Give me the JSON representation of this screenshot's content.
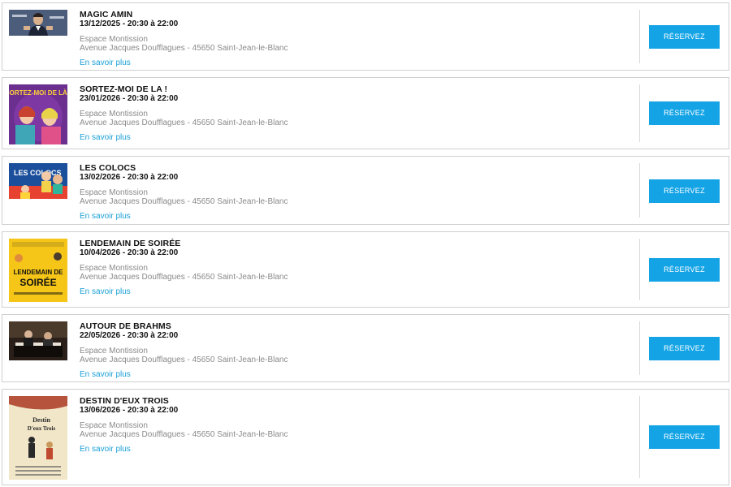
{
  "events": [
    {
      "title": "MAGIC AMIN",
      "datetime": "13/12/2025 - 20:30 à 22:00",
      "venue": "Espace Montission",
      "address": "Avenue Jacques Doufflagues - 45650 Saint-Jean-le-Blanc",
      "more_label": "En savoir plus",
      "reserve_label": "RÉSERVEZ",
      "image": "magician-portrait"
    },
    {
      "title": "SORTEZ-MOI DE LA !",
      "datetime": "23/01/2026 - 20:30 à 22:00",
      "venue": "Espace Montission",
      "address": "Avenue Jacques Doufflagues - 45650 Saint-Jean-le-Blanc",
      "more_label": "En savoir plus",
      "reserve_label": "RÉSERVEZ",
      "image": "comedy-poster-purple",
      "poster_text": "SORTEZ-MOI DE LÀ !"
    },
    {
      "title": "LES COLOCS",
      "datetime": "13/02/2026 - 20:30 à 22:00",
      "venue": "Espace Montission",
      "address": "Avenue Jacques Doufflagues - 45650 Saint-Jean-le-Blanc",
      "more_label": "En savoir plus",
      "reserve_label": "RÉSERVEZ",
      "image": "comic-poster-blue",
      "poster_text": "LES COLOCS"
    },
    {
      "title": "LENDEMAIN DE SOIRÉE",
      "datetime": "10/04/2026 - 20:30 à 22:00",
      "venue": "Espace Montission",
      "address": "Avenue Jacques Doufflagues - 45650 Saint-Jean-le-Blanc",
      "more_label": "En savoir plus",
      "reserve_label": "RÉSERVEZ",
      "image": "yellow-poster",
      "poster_text_1": "LENDEMAIN DE",
      "poster_text_2": "SOIRÉE"
    },
    {
      "title": "AUTOUR DE BRAHMS",
      "datetime": "22/05/2026 - 20:30 à 22:00",
      "venue": "Espace Montission",
      "address": "Avenue Jacques Doufflagues - 45650 Saint-Jean-le-Blanc",
      "more_label": "En savoir plus",
      "reserve_label": "RÉSERVEZ",
      "image": "piano-concert-photo"
    },
    {
      "title": "DESTIN D'EUX TROIS",
      "datetime": "13/06/2026 - 20:30 à 22:00",
      "venue": "Espace Montission",
      "address": "Avenue Jacques Doufflagues - 45650 Saint-Jean-le-Blanc",
      "more_label": "En savoir plus",
      "reserve_label": "RÉSERVEZ",
      "image": "illustrated-poster-cream",
      "poster_text_1": "Destin",
      "poster_text_2": "D'eux Trois"
    }
  ],
  "colors": {
    "accent": "#14a4e6",
    "link": "#1ba0d6",
    "border": "#cfcfcf",
    "muted_text": "#8a8a8a"
  }
}
